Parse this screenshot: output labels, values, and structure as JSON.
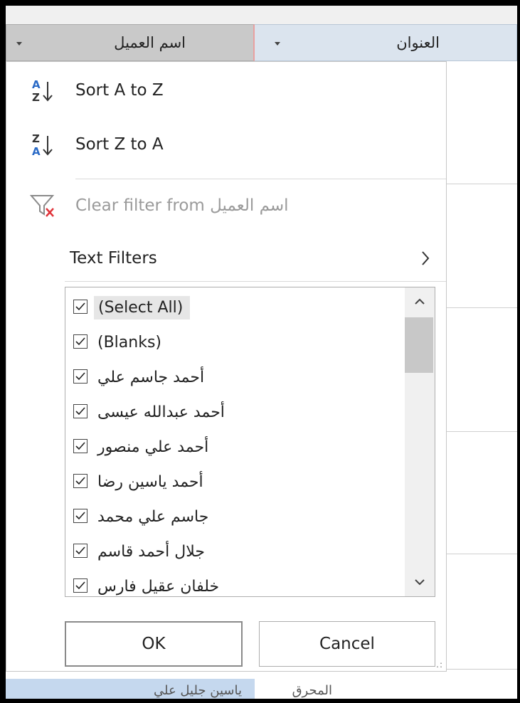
{
  "headers": {
    "name_col": "اسم العميل",
    "title_col": "العنوان"
  },
  "menu": {
    "sort_az": "Sort A to Z",
    "sort_za": "Sort Z to A",
    "clear_filter": "Clear filter from اسم العميل",
    "text_filters": "Text Filters"
  },
  "list": {
    "items": [
      "(Select All)",
      "(Blanks)",
      "أحمد جاسم علي",
      "أحمد عبدالله عيسى",
      "أحمد علي منصور",
      "أحمد ياسين رضا",
      "جاسم علي محمد",
      "جلال أحمد قاسم",
      "خلفان عقيل فارس"
    ]
  },
  "buttons": {
    "ok": "OK",
    "cancel": "Cancel"
  },
  "background_rows": {
    "bottom_left": "ياسين جليل علي",
    "bottom_right": "المحرق"
  },
  "colors": {
    "header_selected": "#c9c9c9",
    "header_other": "#dbe4ee",
    "clear_x": "#e0343a",
    "sort_icon_blue": "#2a6ac6"
  }
}
